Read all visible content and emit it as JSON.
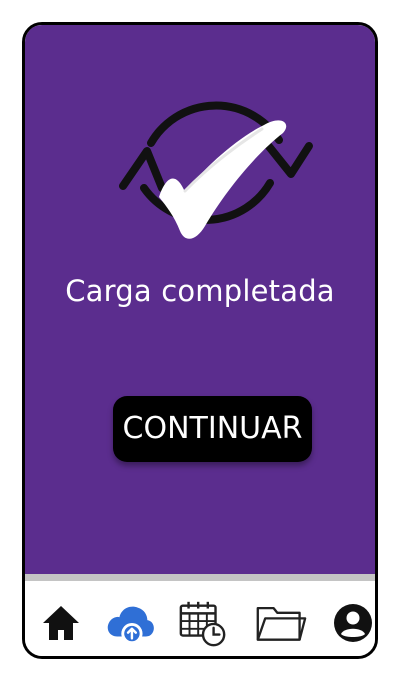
{
  "status": {
    "message": "Carga completada"
  },
  "actions": {
    "continue_label": "CONTINUAR"
  },
  "theme": {
    "background": "#5b2d8e",
    "button": "#000000",
    "active_icon": "#2f6fd6"
  },
  "nav": {
    "items": [
      {
        "icon": "home-icon",
        "active": false
      },
      {
        "icon": "cloud-upload-icon",
        "active": true
      },
      {
        "icon": "calendar-clock-icon",
        "active": false
      },
      {
        "icon": "folder-icon",
        "active": false
      },
      {
        "icon": "user-icon",
        "active": false
      }
    ]
  }
}
